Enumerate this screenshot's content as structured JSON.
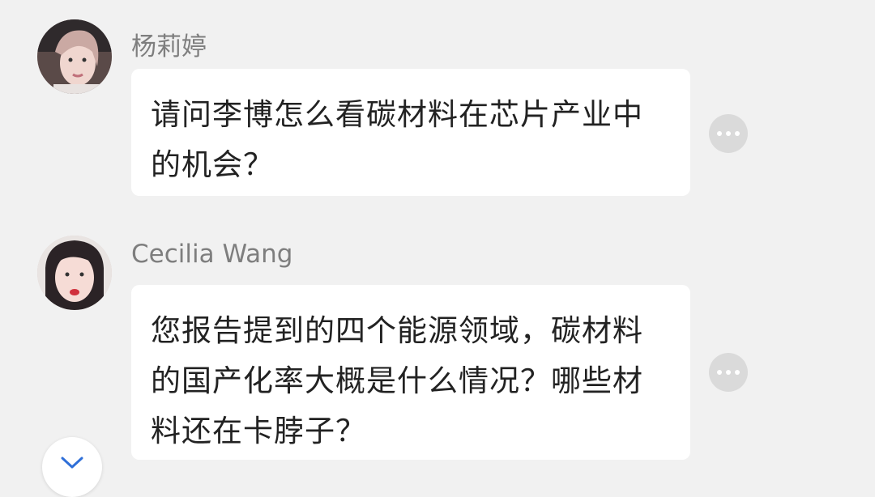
{
  "messages": [
    {
      "author": "杨莉婷",
      "text": "请问李博怎么看碳材料在芯片产业中的机会？",
      "avatar_icon": "user-photo-avatar",
      "more_icon": "more-options-icon"
    },
    {
      "author": "Cecilia Wang",
      "text": "您报告提到的四个能源领域，碳材料的国产化率大概是什么情况？哪些材料还在卡脖子？",
      "avatar_icon": "user-photo-avatar",
      "more_icon": "more-options-icon"
    }
  ],
  "fab": {
    "icon": "chevron-down-icon"
  },
  "colors": {
    "background": "#f1f1f1",
    "bubble": "#ffffff",
    "name": "#7e7e7e",
    "text": "#222222",
    "more_button": "#dadada",
    "fab_icon": "#2f6fd8"
  }
}
